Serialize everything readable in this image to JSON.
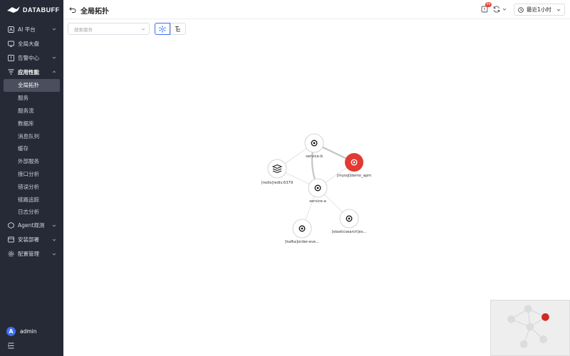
{
  "brand": {
    "name": "DATABUFF"
  },
  "sidebar": {
    "items": [
      {
        "label": "AI 平台",
        "icon": "ai-icon",
        "expandable": true
      },
      {
        "label": "全局大盘",
        "icon": "dashboard-icon",
        "expandable": false
      },
      {
        "label": "告警中心",
        "icon": "alarm-icon",
        "expandable": true
      },
      {
        "label": "应用性能",
        "icon": "filter-icon",
        "expandable": true,
        "expanded": true
      }
    ],
    "apm_children": [
      {
        "label": "全局拓扑",
        "active": true
      },
      {
        "label": "服务"
      },
      {
        "label": "服务流"
      },
      {
        "label": "数据库"
      },
      {
        "label": "消息队列"
      },
      {
        "label": "缓存"
      },
      {
        "label": "外部服务"
      },
      {
        "label": "接口分析"
      },
      {
        "label": "错误分析"
      },
      {
        "label": "链路追踪"
      },
      {
        "label": "日志分析"
      }
    ],
    "bottom_items": [
      {
        "label": "Agent观测",
        "icon": "agent-icon"
      },
      {
        "label": "安装部署",
        "icon": "install-icon"
      },
      {
        "label": "配置管理",
        "icon": "config-icon"
      }
    ],
    "user": {
      "initial": "A",
      "name": "admin"
    }
  },
  "header": {
    "title": "全局拓扑",
    "alert_badge": "99",
    "time_range": "最近1小时"
  },
  "toolbar": {
    "search_placeholder": "搜索服务"
  },
  "graph": {
    "nodes": [
      {
        "id": "service-b",
        "label": "service-b",
        "kind": "service",
        "status": "normal"
      },
      {
        "id": "mysql",
        "label": "[mysql]demo_apm",
        "kind": "database",
        "status": "error"
      },
      {
        "id": "redis",
        "label": "[redis]redis:6379",
        "kind": "cache",
        "status": "normal"
      },
      {
        "id": "service-a",
        "label": "service-a",
        "kind": "service",
        "status": "normal"
      },
      {
        "id": "es",
        "label": "[elasticsearch]es...",
        "kind": "external",
        "status": "normal"
      },
      {
        "id": "kafka",
        "label": "[kafka]order-eve...",
        "kind": "mq",
        "status": "normal"
      }
    ],
    "edges": [
      {
        "from": "service-b",
        "to": "mysql",
        "weight": "heavy"
      },
      {
        "from": "service-b",
        "to": "service-a",
        "weight": "heavy"
      },
      {
        "from": "service-b",
        "to": "redis",
        "weight": "light"
      },
      {
        "from": "service-a",
        "to": "mysql",
        "weight": "light"
      },
      {
        "from": "service-a",
        "to": "redis",
        "weight": "light"
      },
      {
        "from": "service-a",
        "to": "es",
        "weight": "light"
      },
      {
        "from": "service-a",
        "to": "kafka",
        "weight": "light"
      }
    ]
  },
  "colors": {
    "sidebar_bg": "#262a37",
    "accent": "#3d6df2",
    "error": "#e03a33",
    "badge": "#e8453c"
  }
}
